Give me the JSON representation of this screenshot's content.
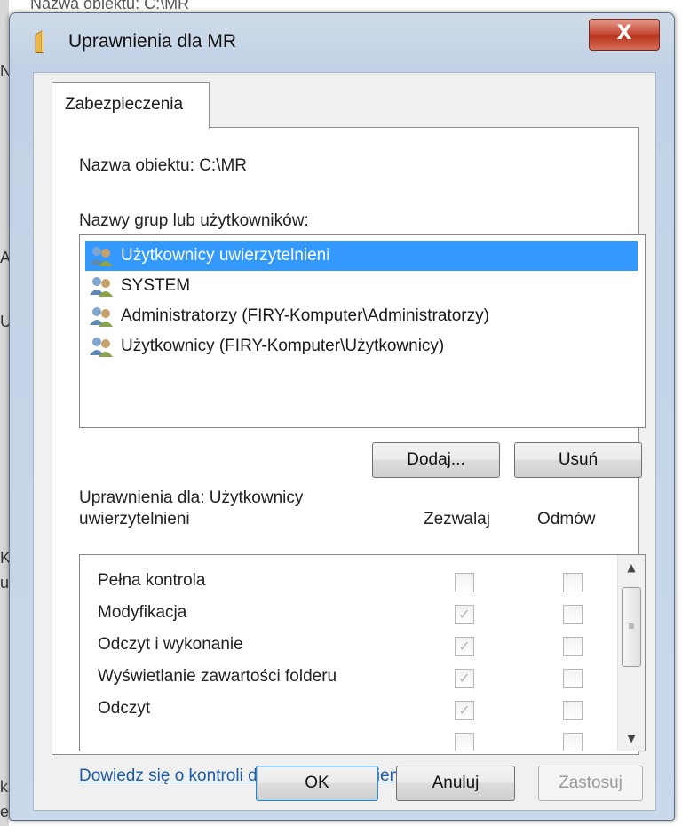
{
  "background": {
    "fragment_top": "Nazwa obiektu: C:\\MR",
    "left_letters": [
      "N",
      "A",
      "U",
      "K",
      "u",
      "k",
      "e"
    ]
  },
  "window": {
    "title": "Uprawnienia dla MR",
    "close_label": "X",
    "icon": "folder-icon"
  },
  "tab": {
    "label": "Zabezpieczenia"
  },
  "object_name": {
    "label": "Nazwa obiektu:",
    "value": "C:\\MR"
  },
  "groups": {
    "label": "Nazwy grup lub użytkowników:",
    "items": [
      {
        "label": "Użytkownicy uwierzytelnieni",
        "icon": "users-icon",
        "selected": true
      },
      {
        "label": "SYSTEM",
        "icon": "users-icon",
        "selected": false
      },
      {
        "label": "Administratorzy (FIRY-Komputer\\Administratorzy)",
        "icon": "users-icon",
        "selected": false
      },
      {
        "label": "Użytkownicy (FIRY-Komputer\\Użytkownicy)",
        "icon": "users-icon",
        "selected": false
      }
    ]
  },
  "buttons": {
    "add": "Dodaj...",
    "remove": "Usuń"
  },
  "permissions": {
    "label_line1": "Uprawnienia dla: Użytkownicy",
    "label_line2": "uwierzytelnieni",
    "allow_header": "Zezwalaj",
    "deny_header": "Odmów",
    "rows": [
      {
        "name": "Pełna kontrola",
        "allow": false,
        "deny": false
      },
      {
        "name": "Modyfikacja",
        "allow": true,
        "deny": false
      },
      {
        "name": "Odczyt i wykonanie",
        "allow": true,
        "deny": false
      },
      {
        "name": "Wyświetlanie zawartości folderu",
        "allow": true,
        "deny": false
      },
      {
        "name": "Odczyt",
        "allow": true,
        "deny": false
      }
    ]
  },
  "link": {
    "text": "Dowiedz się o kontroli dostępu i uprawnieniach"
  },
  "footer": {
    "ok": "OK",
    "cancel": "Anuluj",
    "apply": "Zastosuj"
  },
  "colors": {
    "selection": "#3399ff",
    "link": "#1a5aa6",
    "close_button": "#c4442f"
  }
}
